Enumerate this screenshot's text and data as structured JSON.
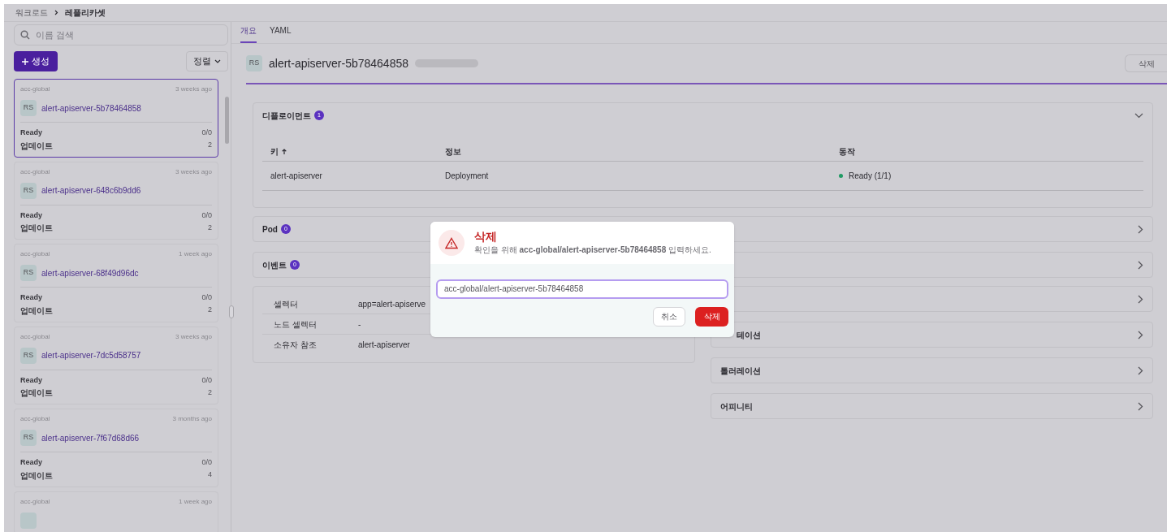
{
  "breadcrumb": [
    "워크로드",
    "레플리카셋"
  ],
  "sidebar": {
    "search": {
      "placeholder": "이름 검색"
    },
    "create_button": "생성",
    "sort_button": "정렬",
    "items": [
      {
        "namespace": "acc-global",
        "age": "3 weeks ago",
        "avatar": "RS",
        "name": "alert-apiserver-5b78464858",
        "ready_label": "Ready",
        "ready": "0/0",
        "update_label": "업데이트",
        "update": "2",
        "selected": true
      },
      {
        "namespace": "acc-global",
        "age": "3 weeks ago",
        "avatar": "RS",
        "name": "alert-apiserver-648c6b9dd6",
        "ready_label": "Ready",
        "ready": "0/0",
        "update_label": "업데이트",
        "update": "2",
        "selected": false
      },
      {
        "namespace": "acc-global",
        "age": "1 week ago",
        "avatar": "RS",
        "name": "alert-apiserver-68f49d96dc",
        "ready_label": "Ready",
        "ready": "0/0",
        "update_label": "업데이트",
        "update": "2",
        "selected": false
      },
      {
        "namespace": "acc-global",
        "age": "3 weeks ago",
        "avatar": "RS",
        "name": "alert-apiserver-7dc5d58757",
        "ready_label": "Ready",
        "ready": "0/0",
        "update_label": "업데이트",
        "update": "2",
        "selected": false
      },
      {
        "namespace": "acc-global",
        "age": "3 months ago",
        "avatar": "RS",
        "name": "alert-apiserver-7f67d68d66",
        "ready_label": "Ready",
        "ready": "0/0",
        "update_label": "업데이트",
        "update": "4",
        "selected": false
      },
      {
        "namespace": "acc-global",
        "age": "1 week ago",
        "selected": false
      }
    ]
  },
  "tabs": [
    {
      "label": "개요",
      "selected": true
    },
    {
      "label": "YAML",
      "selected": false
    }
  ],
  "header": {
    "avatar": "RS",
    "title": "alert-apiserver-5b78464858",
    "delete_button": "삭제"
  },
  "deployments": {
    "title": "디플로이먼트",
    "count": "1",
    "expanded": true,
    "columns": [
      "키",
      "정보",
      "동작"
    ],
    "rows": [
      {
        "key": "alert-apiserver",
        "info": "Deployment",
        "status": "Ready (1/1)",
        "color": "#1f9a63"
      }
    ]
  },
  "sections": [
    {
      "title": "Pod",
      "count": "0",
      "expanded": false
    },
    {
      "title": "이벤트",
      "count": "0",
      "expanded": false
    }
  ],
  "details": [
    {
      "label": "셀렉터",
      "value": "app=alert-apiserve"
    },
    {
      "label": "노드 셀렉터",
      "value": "-"
    },
    {
      "label": "소유자 참조",
      "value": "alert-apiserver"
    }
  ],
  "side_sections": [
    {
      "expanded": false,
      "kind": "full"
    },
    {
      "title": "테이션",
      "expanded": false,
      "kind": "clipped"
    },
    {
      "title": "톨러레이션",
      "expanded": false,
      "kind": "full"
    },
    {
      "title": "어피니티",
      "expanded": false,
      "kind": "full"
    }
  ],
  "dialog": {
    "title": "삭제",
    "message": "확인을 위해 **acc-global/alert-apiserver-5b78464858** 입력하세요.",
    "value": "acc-global/alert-apiserver-5b78464858",
    "cancel": "취소",
    "confirm": "삭제"
  }
}
